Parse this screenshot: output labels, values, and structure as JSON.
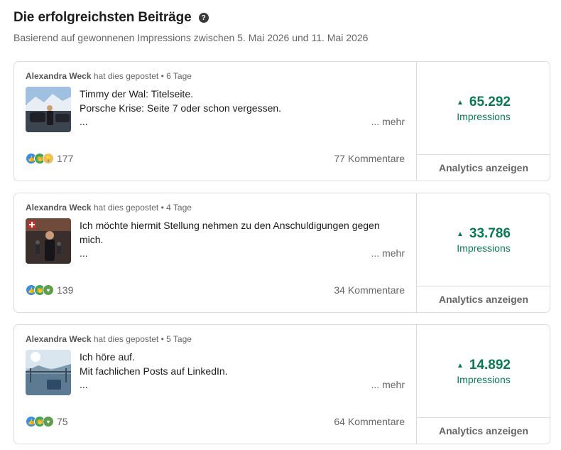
{
  "header": {
    "title": "Die erfolgreichsten Beiträge",
    "help_icon": "?",
    "subtitle": "Basierend auf gewonnenen Impressions zwischen 5. Mai 2026 und 11. Mai 2026"
  },
  "posts": [
    {
      "author": "Alexandra Weck",
      "posted_text": "hat dies gepostet",
      "separator": "•",
      "age": "6 Tage",
      "line1": "Timmy der Wal: Titelseite.",
      "line2": "Porsche Krise: Seite 7 oder schon vergessen.",
      "ellipsis": "...",
      "more": "... mehr",
      "reactions": [
        "like",
        "celebrate",
        "insight"
      ],
      "reaction_count": "177",
      "comments": "77 Kommentare",
      "impressions": "65.292",
      "impressions_label": "Impressions",
      "analytics": "Analytics anzeigen"
    },
    {
      "author": "Alexandra Weck",
      "posted_text": "hat dies gepostet",
      "separator": "•",
      "age": "4 Tage",
      "line1": "Ich möchte hiermit Stellung nehmen zu den Anschuldigungen gegen",
      "line2": "mich.",
      "ellipsis": "...",
      "more": "... mehr",
      "reactions": [
        "like",
        "celebrate",
        "support"
      ],
      "reaction_count": "139",
      "comments": "34 Kommentare",
      "impressions": "33.786",
      "impressions_label": "Impressions",
      "analytics": "Analytics anzeigen"
    },
    {
      "author": "Alexandra Weck",
      "posted_text": "hat dies gepostet",
      "separator": "•",
      "age": "5 Tage",
      "line1": "Ich höre auf.",
      "line2": "Mit fachlichen Posts auf LinkedIn.",
      "ellipsis": "...",
      "more": "... mehr",
      "reactions": [
        "like",
        "celebrate",
        "support"
      ],
      "reaction_count": "75",
      "comments": "64 Kommentare",
      "impressions": "14.892",
      "impressions_label": "Impressions",
      "analytics": "Analytics anzeigen"
    }
  ],
  "colors": {
    "impressions_green": "#0a7a52",
    "border": "#dcdcdc",
    "muted_text": "#666666"
  }
}
